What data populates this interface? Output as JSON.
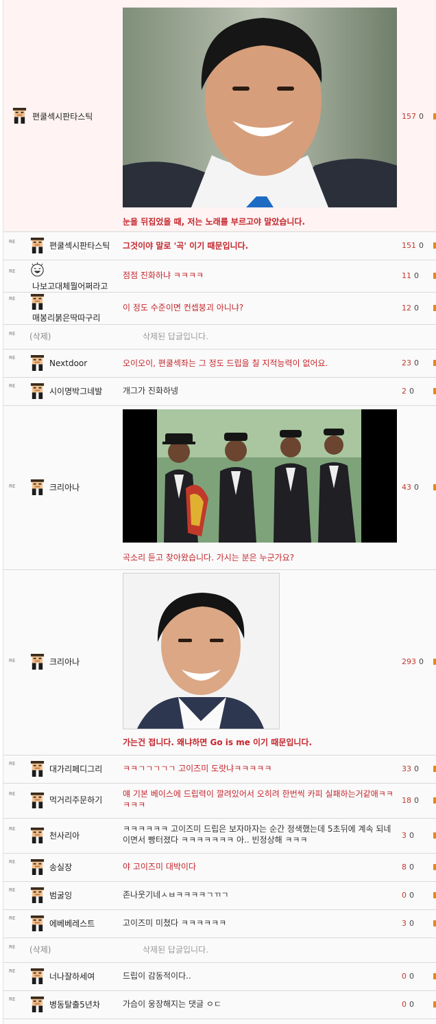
{
  "comments": [
    {
      "nick": "편쿨섹시판타스틱",
      "text": "눈을 뒤집었을 때, 저는 노래를 부르고야 말았습니다.",
      "up": "157",
      "down": "0"
    },
    {
      "re": "RE",
      "nick": "편쿨섹시판타스틱",
      "text": "그것이야 말로 '곡' 이기 때문입니다.",
      "up": "151",
      "down": "0"
    },
    {
      "re": "RE",
      "nick": "나보고대체뭘어쩌라고",
      "text": "점점 진화하냐 ㅋㅋㅋㅋ",
      "up": "11",
      "down": "0"
    },
    {
      "re": "RE",
      "nick": "매봉리붉은딱따구리",
      "text": "이 정도 수준이면 컨셉붕괴 아니냐?",
      "up": "12",
      "down": "0"
    },
    {
      "re": "RE",
      "nick": "(삭제)",
      "text": "삭제된 답글입니다."
    },
    {
      "re": "RE",
      "nick": "Nextdoor",
      "text": "오이오이, 편쿨섹좌는 그 정도 드립을 칠 지적능력이 없어요.",
      "up": "23",
      "down": "0"
    },
    {
      "re": "RE",
      "nick": "시이명박그네발",
      "text": "개그가 진화하넹",
      "up": "2",
      "down": "0"
    },
    {
      "re": "RE",
      "nick": "크리아나",
      "text": "곡소리 듣고 찾아왔습니다. 가시는 분은 누군가요?",
      "up": "43",
      "down": "0"
    },
    {
      "re": "RE",
      "nick": "크리아나",
      "text": "가는건 접니다. 왜냐하면 Go is me 이기 때문입니다.",
      "up": "293",
      "down": "0"
    },
    {
      "re": "RE",
      "nick": "대가리페디그리",
      "text": "ㅋㅋㄱㄱㄱㄱㄱ 고이즈미 도랏냐ㅋㅋㅋㅋㅋ",
      "up": "33",
      "down": "0"
    },
    {
      "re": "RE",
      "nick": "먹거리주문하기",
      "text": "얘 기본 베이스에 드립력이 깔려있어서 오히려 한번씩 카피 실패하는거같애ㅋㅋㅋㅋㅋ",
      "up": "18",
      "down": "0"
    },
    {
      "re": "RE",
      "nick": "천사리아",
      "text": "ㅋㅋㅋㅋㅋㅋ 고이즈미 드립은 보자마자는 순간 정색했는데 5초뒤에 계속 되네이면서 빵터졌다 ㅋㅋㅋㅋㅋㅋㅋ 아.. 빈정상해 ㅋㅋㅋ",
      "up": "3",
      "down": "0"
    },
    {
      "re": "RE",
      "nick": "송실장",
      "text": "야 고이즈미 대박이다",
      "up": "8",
      "down": "0"
    },
    {
      "re": "RE",
      "nick": "범굴잉",
      "text": "존나웃기네ㅅㅂㅋㅋㅋㅋㄱㄲㄱ",
      "up": "0",
      "down": "0"
    },
    {
      "re": "RE",
      "nick": "에베베레스트",
      "text": "고이즈미 미쳤다 ㅋㅋㅋㅋㅋㅋ",
      "up": "3",
      "down": "0"
    },
    {
      "re": "RE",
      "nick": "(삭제)",
      "text": "삭제된 답글입니다."
    },
    {
      "re": "RE",
      "nick": "너나잘하세여",
      "text": "드립이 감동적이다..",
      "up": "0",
      "down": "0"
    },
    {
      "re": "RE",
      "nick": "병동탈출5년차",
      "text": "가슴이 웅장해지는 댓글 ㅇㄷ",
      "up": "0",
      "down": "0"
    }
  ],
  "colors": {
    "upvote": "#c0392b",
    "red_text": "#c4252c",
    "marker": "#e8861c"
  },
  "icons": {
    "reply": "reply-arrow-icon",
    "avatar": "pixel-avatar-icon",
    "emoticon": "laughing-face-icon"
  }
}
